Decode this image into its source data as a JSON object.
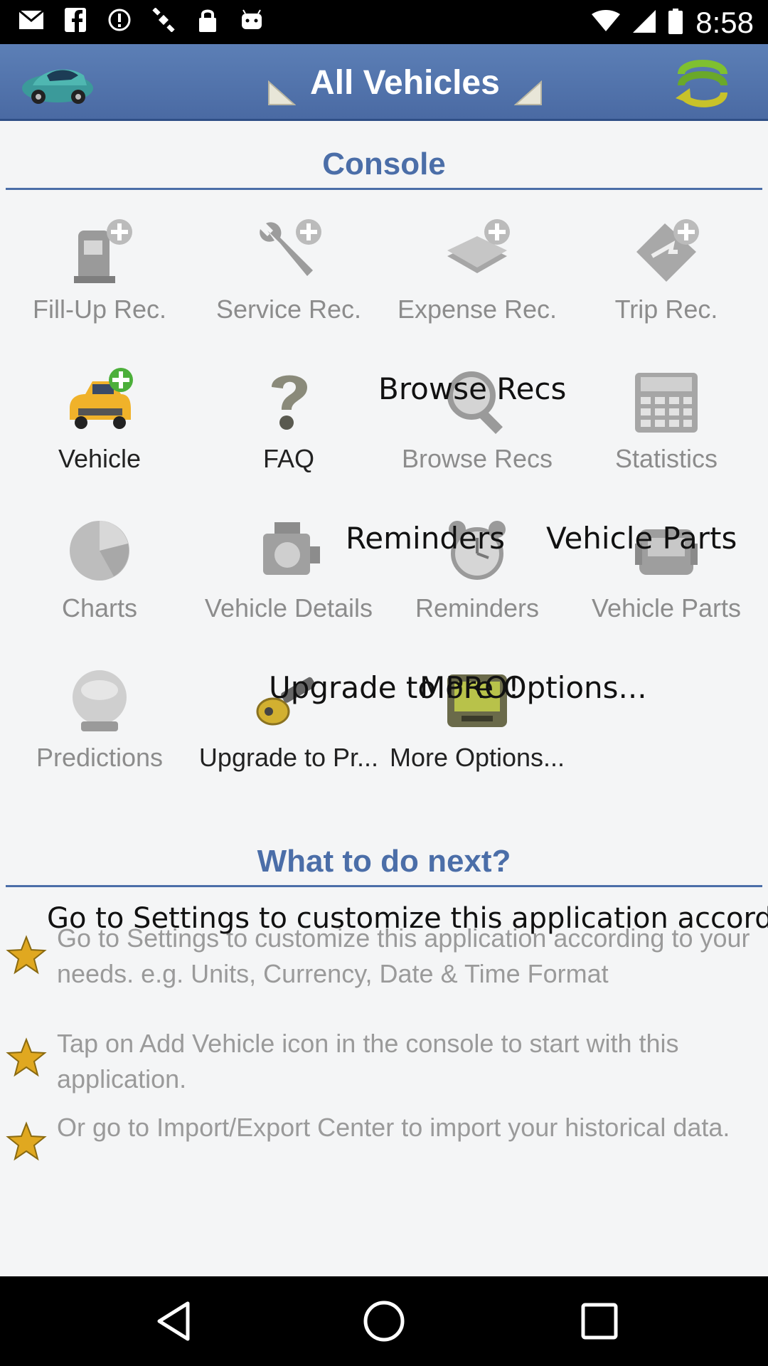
{
  "status_bar": {
    "time": "8:58",
    "icons": [
      "mail-icon",
      "facebook-icon",
      "alert-icon",
      "satellite-icon",
      "lock-icon",
      "android-icon"
    ]
  },
  "app_bar": {
    "title": "All Vehicles",
    "car_icon": "car-icon",
    "refresh_icon": "refresh-icon"
  },
  "console": {
    "title": "Console",
    "tiles": [
      {
        "label": "Fill-Up Rec.",
        "icon": "fuel-pump-add-icon",
        "enabled": false
      },
      {
        "label": "Service Rec.",
        "icon": "wrench-add-icon",
        "enabled": false
      },
      {
        "label": "Expense Rec.",
        "icon": "money-add-icon",
        "enabled": false
      },
      {
        "label": "Trip Rec.",
        "icon": "trip-add-icon",
        "enabled": false
      },
      {
        "label": "Vehicle",
        "icon": "vehicle-add-icon",
        "enabled": true
      },
      {
        "label": "FAQ",
        "icon": "question-icon",
        "enabled": true
      },
      {
        "label": "Browse Recs",
        "icon": "magnifier-icon",
        "enabled": false
      },
      {
        "label": "Statistics",
        "icon": "calculator-icon",
        "enabled": false
      },
      {
        "label": "Charts",
        "icon": "pie-chart-icon",
        "enabled": false
      },
      {
        "label": "Vehicle Details",
        "icon": "engine-icon",
        "enabled": false
      },
      {
        "label": "Reminders",
        "icon": "alarm-clock-icon",
        "enabled": false
      },
      {
        "label": "Vehicle Parts",
        "icon": "parts-icon",
        "enabled": false
      },
      {
        "label": "Predictions",
        "icon": "crystal-ball-icon",
        "enabled": false
      },
      {
        "label": "Upgrade to Pr...",
        "icon": "key-icon",
        "enabled": true
      },
      {
        "label": "More Options...",
        "icon": "device-icon",
        "enabled": true
      }
    ],
    "overlays": {
      "browse": "Browse Recs",
      "reminders": "Reminders",
      "parts": "Vehicle Parts",
      "upgrade": "Upgrade to PRO!",
      "more": "More Options..."
    }
  },
  "next": {
    "title": "What to do next?",
    "tips": [
      "Go to Settings to customize this application according to your needs. e.g. Units, Currency, Date & Time Format",
      "Tap on Add Vehicle icon in the console to start with this application.",
      "Or go to Import/Export Center to import your historical data."
    ],
    "overlay": "Go to Settings to customize this application accordin"
  },
  "nav_bar": {
    "back_icon": "back-icon",
    "home_icon": "home-icon",
    "recents_icon": "recents-icon"
  }
}
